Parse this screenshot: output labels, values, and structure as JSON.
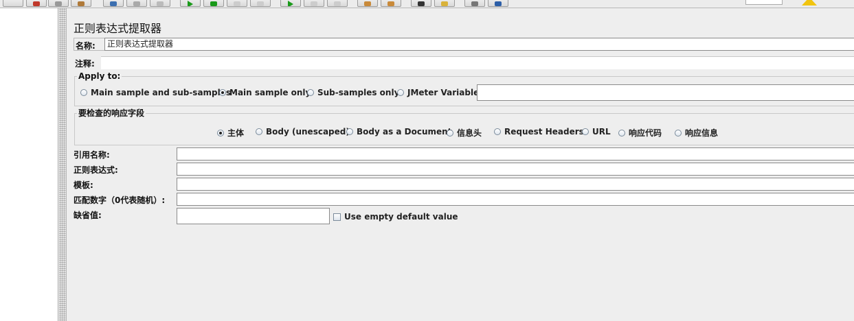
{
  "window": {
    "title": "正则表达式提取器"
  },
  "form": {
    "name_label": "名称:",
    "name_value": "正则表达式提取器",
    "comment_label": "注释:",
    "comment_value": ""
  },
  "apply_to": {
    "legend": "Apply to:",
    "options": [
      {
        "label": "Main sample and sub-samples",
        "selected": false
      },
      {
        "label": "Main sample only",
        "selected": true
      },
      {
        "label": "Sub-samples only",
        "selected": false
      },
      {
        "label": "JMeter Variable",
        "selected": false
      }
    ],
    "variable_value": ""
  },
  "response_field": {
    "legend": "要检查的响应字段",
    "options": [
      {
        "label": "主体",
        "selected": true
      },
      {
        "label": "Body (unescaped)",
        "selected": false
      },
      {
        "label": "Body as a Document",
        "selected": false
      },
      {
        "label": "信息头",
        "selected": false
      },
      {
        "label": "Request Headers",
        "selected": false
      },
      {
        "label": "URL",
        "selected": false
      },
      {
        "label": "响应代码",
        "selected": false
      },
      {
        "label": "响应信息",
        "selected": false
      }
    ]
  },
  "fields": {
    "ref_name_label": "引用名称:",
    "ref_name_value": "",
    "regex_label": "正则表达式:",
    "regex_value": "",
    "template_label": "模板:",
    "template_value": "",
    "match_no_label": "匹配数字（0代表随机）:",
    "match_no_value": "",
    "default_label": "缺省值:",
    "default_value": "",
    "use_empty_default_label": "Use empty default value",
    "use_empty_default_checked": false
  },
  "icons": [
    "cut-icon",
    "copy-icon",
    "paste-icon",
    "expand-icon",
    "collapse-icon",
    "toggle-icon",
    "start-icon",
    "start-no-pause-icon",
    "stop-icon",
    "shutdown-icon",
    "remote-start-icon",
    "remote-stop-icon",
    "remote-shutdown-icon",
    "clear-icon",
    "clear-all-icon",
    "search-icon",
    "reset-search-icon",
    "function-helper-icon",
    "help-icon",
    "warning-icon"
  ],
  "colors": {
    "background": "#eeeeee",
    "accent_green": "#1a9a1a",
    "warning": "#f1c40f"
  }
}
